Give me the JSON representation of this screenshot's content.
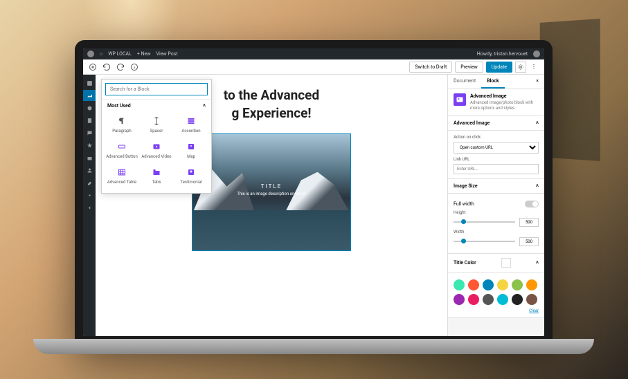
{
  "adminBar": {
    "site": "WP LOCAL",
    "new": "+ New",
    "viewPost": "View Post",
    "greeting": "Howdy, tristan.hervouet"
  },
  "topBar": {
    "switchDraft": "Switch to Draft",
    "preview": "Preview",
    "update": "Update"
  },
  "inserter": {
    "searchPlaceholder": "Search for a Block",
    "mostUsed": "Most Used",
    "blocks": [
      "Paragraph",
      "Spacer",
      "Accordion",
      "Advanced Button",
      "Advanced Video",
      "Map",
      "Advanced Table",
      "Tabs",
      "Testimonial"
    ]
  },
  "content": {
    "titleLine1": "to the Advanced",
    "titleLine2": "g Experience!",
    "overlayTitle": "TITLE",
    "overlayDesc": "This is an image description on hover"
  },
  "sidebar": {
    "tabDocument": "Document",
    "tabBlock": "Block",
    "blockName": "Advanced Image",
    "blockDesc": "Advanced image/photo block with more options and styles.",
    "sectionAdvImage": "Advanced Image",
    "actionOnClick": "Action on click",
    "actionValue": "Open custom URL",
    "linkUrl": "Link URL",
    "linkPlaceholder": "Enter URL...",
    "sectionImageSize": "Image Size",
    "fullWidth": "Full width",
    "height": "Height",
    "heightVal": "500",
    "width": "Width",
    "widthVal": "500",
    "sectionTitleColor": "Title Color",
    "clear": "Clear",
    "colors": [
      "#3be8b0",
      "#ff5733",
      "#0085ba",
      "#f5d442",
      "#8bc34a",
      "#ff9800",
      "#9c27b0",
      "#e91e63",
      "#555555",
      "#00bcd4",
      "#222222",
      "#795548"
    ]
  }
}
